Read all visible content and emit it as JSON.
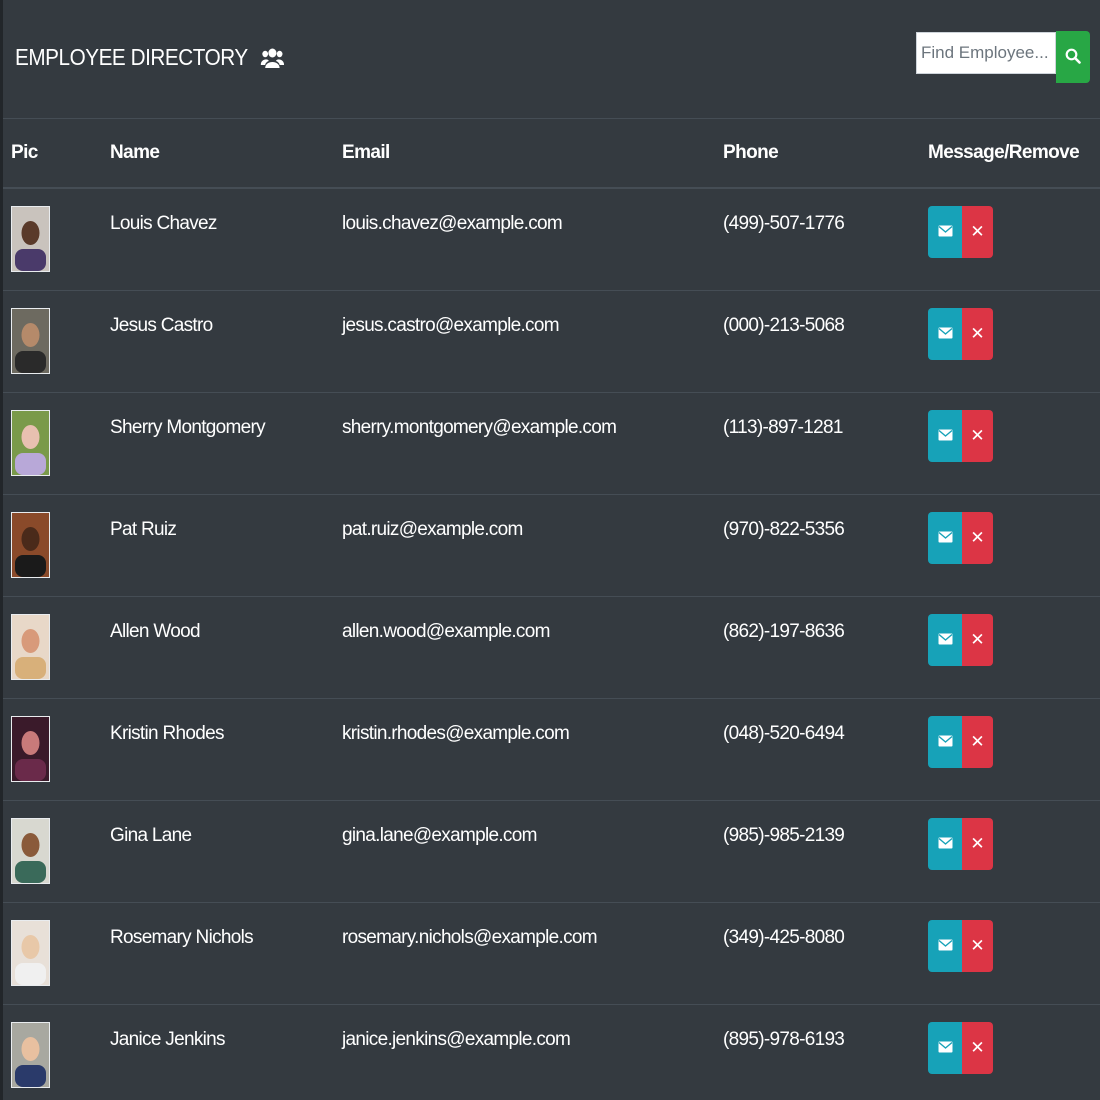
{
  "header": {
    "title": "EMPLOYEE DIRECTORY",
    "title_icon": "users-icon"
  },
  "search": {
    "placeholder": "Find Employee...",
    "value": "",
    "button_icon": "search-icon"
  },
  "table": {
    "columns": [
      "Pic",
      "Name",
      "Email",
      "Phone",
      "Message/Remove"
    ],
    "rows": [
      {
        "name": "Louis Chavez",
        "email": "louis.chavez@example.com",
        "phone": "(499)-507-1776",
        "avatar_bg": "#c9c3bd",
        "avatar_skin": "#5a3a2a",
        "avatar_shirt": "#4a3a6a"
      },
      {
        "name": "Jesus Castro",
        "email": "jesus.castro@example.com",
        "phone": "(000)-213-5068",
        "avatar_bg": "#6d6a60",
        "avatar_skin": "#b58a6a",
        "avatar_shirt": "#2a2a2a"
      },
      {
        "name": "Sherry Montgomery",
        "email": "sherry.montgomery@example.com",
        "phone": "(113)-897-1281",
        "avatar_bg": "#7a9a4a",
        "avatar_skin": "#e8c0b0",
        "avatar_shirt": "#b8a8d8"
      },
      {
        "name": "Pat Ruiz",
        "email": "pat.ruiz@example.com",
        "phone": "(970)-822-5356",
        "avatar_bg": "#8a4a2a",
        "avatar_skin": "#4a2a1a",
        "avatar_shirt": "#1a1a1a"
      },
      {
        "name": "Allen Wood",
        "email": "allen.wood@example.com",
        "phone": "(862)-197-8636",
        "avatar_bg": "#e8d8c8",
        "avatar_skin": "#d89a7a",
        "avatar_shirt": "#d8b07a"
      },
      {
        "name": "Kristin Rhodes",
        "email": "kristin.rhodes@example.com",
        "phone": "(048)-520-6494",
        "avatar_bg": "#3a1a2a",
        "avatar_skin": "#c87a7a",
        "avatar_shirt": "#6a2a4a"
      },
      {
        "name": "Gina Lane",
        "email": "gina.lane@example.com",
        "phone": "(985)-985-2139",
        "avatar_bg": "#d8d8d0",
        "avatar_skin": "#8a5a3a",
        "avatar_shirt": "#3a6a5a"
      },
      {
        "name": "Rosemary Nichols",
        "email": "rosemary.nichols@example.com",
        "phone": "(349)-425-8080",
        "avatar_bg": "#e8e0d8",
        "avatar_skin": "#e8c8a8",
        "avatar_shirt": "#f0f0f0"
      },
      {
        "name": "Janice Jenkins",
        "email": "janice.jenkins@example.com",
        "phone": "(895)-978-6193",
        "avatar_bg": "#a8a8a0",
        "avatar_skin": "#e8c0a0",
        "avatar_shirt": "#2a3a6a"
      }
    ]
  },
  "colors": {
    "background": "#343a40",
    "message_button": "#17a2b8",
    "remove_button": "#dc3545",
    "search_button": "#28a745"
  },
  "row_icons": {
    "message": "envelope-icon",
    "remove": "close-icon"
  }
}
